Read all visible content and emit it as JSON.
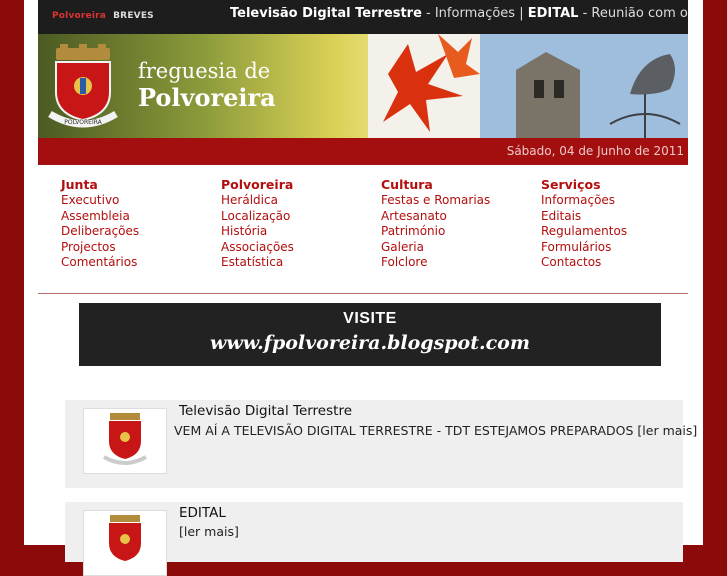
{
  "topbar": {
    "brand_primary": "Polvoreira",
    "brand_secondary": "BREVES",
    "ticker_item1_title": "Televisão Digital Terrestre",
    "ticker_item1_text": " - Informações | ",
    "ticker_item2_title": "EDITAL",
    "ticker_item2_text": " - Reunião com os delegados"
  },
  "banner": {
    "title_small": "freguesia de",
    "title_big": "Polvoreira",
    "crest_label": "POLVOREIRA"
  },
  "date": "Sábado, 04 de Junho de 2011",
  "nav": [
    {
      "heading": "Junta",
      "items": [
        "Executivo",
        "Assembleia",
        "Deliberações",
        "Projectos",
        "Comentários"
      ]
    },
    {
      "heading": "Polvoreira",
      "items": [
        "Heráldica",
        "Localização",
        "História",
        "Associações",
        "Estatística"
      ]
    },
    {
      "heading": "Cultura",
      "items": [
        "Festas e Romarias",
        "Artesanato",
        "Património",
        "Galeria",
        "Folclore"
      ]
    },
    {
      "heading": "Serviços",
      "items": [
        "Informações",
        "Editais",
        "Regulamentos",
        "Formulários",
        "Contactos"
      ]
    }
  ],
  "ad": {
    "visit": "VISITE",
    "url": "www.fpolvoreira.blogspot.com"
  },
  "news": [
    {
      "title": "Televisão Digital Terrestre",
      "text": "VEM AÍ A TELEVISÃO DIGITAL TERRESTRE - TDT ESTEJAMOS PREPARADOS [ler mais]"
    },
    {
      "title": "EDITAL",
      "text": "[ler mais]"
    }
  ],
  "colors": {
    "accent": "#a30f0f",
    "link": "#b30e0e",
    "outer": "#8b0a0a"
  }
}
